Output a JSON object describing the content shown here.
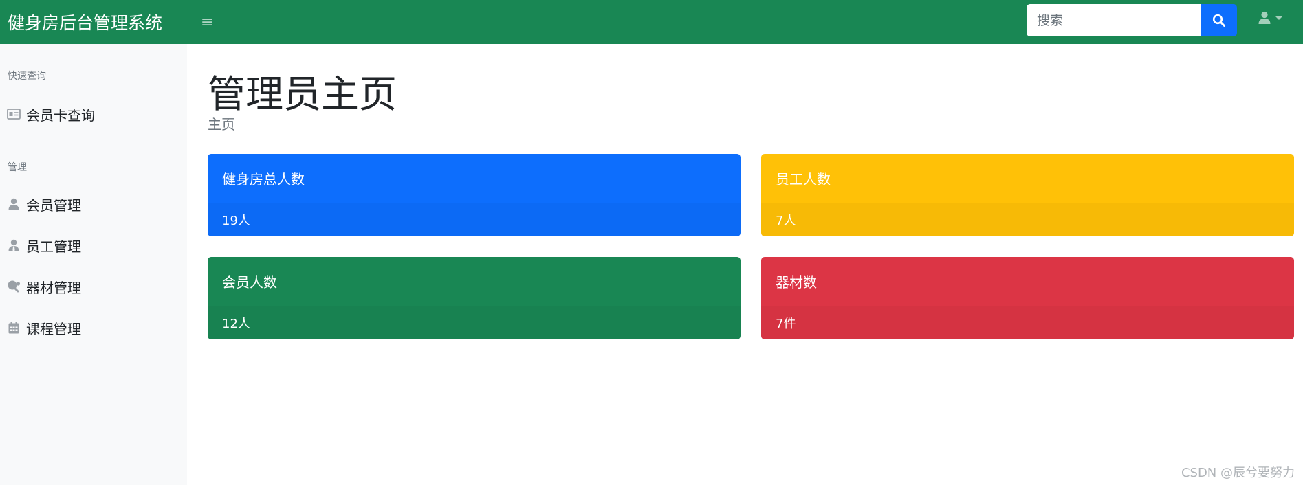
{
  "app": {
    "brand": "健身房后台管理系统",
    "toggle_icon": "menu-icon"
  },
  "search": {
    "placeholder": "搜索",
    "value": "",
    "icon": "search-icon"
  },
  "user": {
    "icon": "user-icon"
  },
  "sidebar": {
    "sections": [
      {
        "heading": "快速查询",
        "items": [
          {
            "label": "会员卡查询",
            "icon": "id-card-icon"
          }
        ]
      },
      {
        "heading": "管理",
        "items": [
          {
            "label": "会员管理",
            "icon": "user-icon"
          },
          {
            "label": "员工管理",
            "icon": "user-tie-icon"
          },
          {
            "label": "器材管理",
            "icon": "table-tennis-icon"
          },
          {
            "label": "课程管理",
            "icon": "calendar-icon"
          }
        ]
      }
    ]
  },
  "main": {
    "title": "管理员主页",
    "breadcrumb": "主页",
    "cards": [
      {
        "title": "健身房总人数",
        "value": "19人",
        "color": "#0d6efd"
      },
      {
        "title": "员工人数",
        "value": "7人",
        "color": "#ffc107"
      },
      {
        "title": "会员人数",
        "value": "12人",
        "color": "#198754"
      },
      {
        "title": "器材数",
        "value": "7件",
        "color": "#dc3545"
      }
    ]
  },
  "watermark": "CSDN @辰兮要努力",
  "colors": {
    "topbar": "#198754",
    "sidebar_bg": "#f8f9fa",
    "search_button": "#0d6efd"
  }
}
